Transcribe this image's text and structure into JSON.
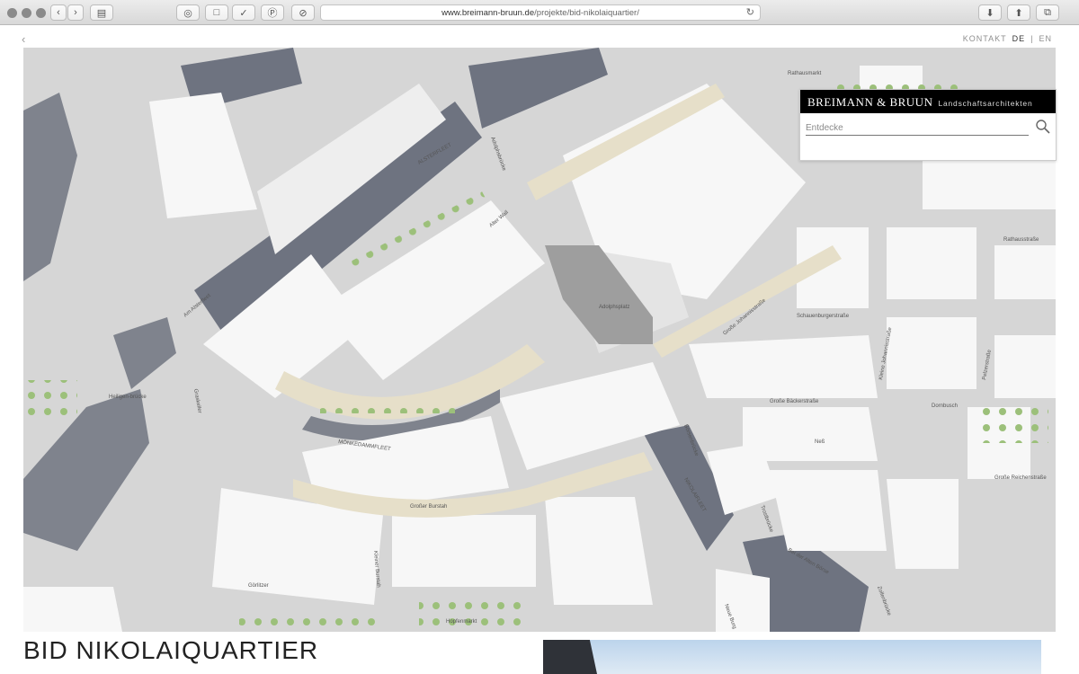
{
  "browser": {
    "url_domain": "www.breimann-bruun.de",
    "url_path": "/projekte/bid-nikolaiquartier/"
  },
  "nav": {
    "back": "‹",
    "kontakt": "KONTAKT",
    "lang_de": "DE",
    "lang_sep": "|",
    "lang_en": "EN"
  },
  "brand": {
    "name": "BREIMANN & BRUUN",
    "subtitle": "Landschaftsarchitekten",
    "search_placeholder": "Entdecke"
  },
  "map_labels": {
    "rathausmarkt": "Rathausmarkt",
    "alsterfleet": "ALSTERFLEET",
    "adolphsbruecke": "Adolphsbrücke",
    "am_alsterfleet": "Am Alsterfleet",
    "alter_wall": "Alter Wall",
    "adolphsplatz": "Adolphsplatz",
    "rathausstrasse": "Rathausstraße",
    "schauenburgerstrasse": "Schauenburgerstraße",
    "grosse_johannisstrasse": "Große Johannisstraße",
    "kleine_johannisstrasse": "Kleine Johannisstraße",
    "pelzerstrasse": "Pelzerstraße",
    "grosse_baeckerstrasse": "Große Bäckerstraße",
    "dornbusch": "Dornbusch",
    "moenkedammfleet": "MÖNKEDAMMFLEET",
    "graskeller": "Graskeller",
    "heiligen_bruecke": "Heiligen-brücke",
    "boersenbruecke": "Börsenbrücke",
    "nikolaifleet": "NIKOLAIFLEET",
    "neß": "Neß",
    "grosser_burstah": "Großer Burstah",
    "kleiner_burstah": "Kleiner Burstah",
    "grosse_reichenstrasse": "Große Reichenstraße",
    "hopfenmarkt": "Hopfenmarkt",
    "trostbruecke": "Trostbrücke",
    "zollenbruecke": "Zollenbrücke",
    "bei_der_alten_boerse": "Bei der Alten Börse",
    "neue_burg": "Neue Burg",
    "gorlitzstr": "Görlitzer",
    "heiligengeistbruecke": "Heiligen-brücke"
  },
  "page": {
    "title": "BID NIKOLAIQUARTIER"
  },
  "colors": {
    "building_dark": "#6e7380",
    "building_light": "#f7f7f7",
    "street": "#d4d4d4",
    "sidewalk": "#e6dfc9",
    "water": "#7f838d",
    "tree": "#9cc07a"
  }
}
